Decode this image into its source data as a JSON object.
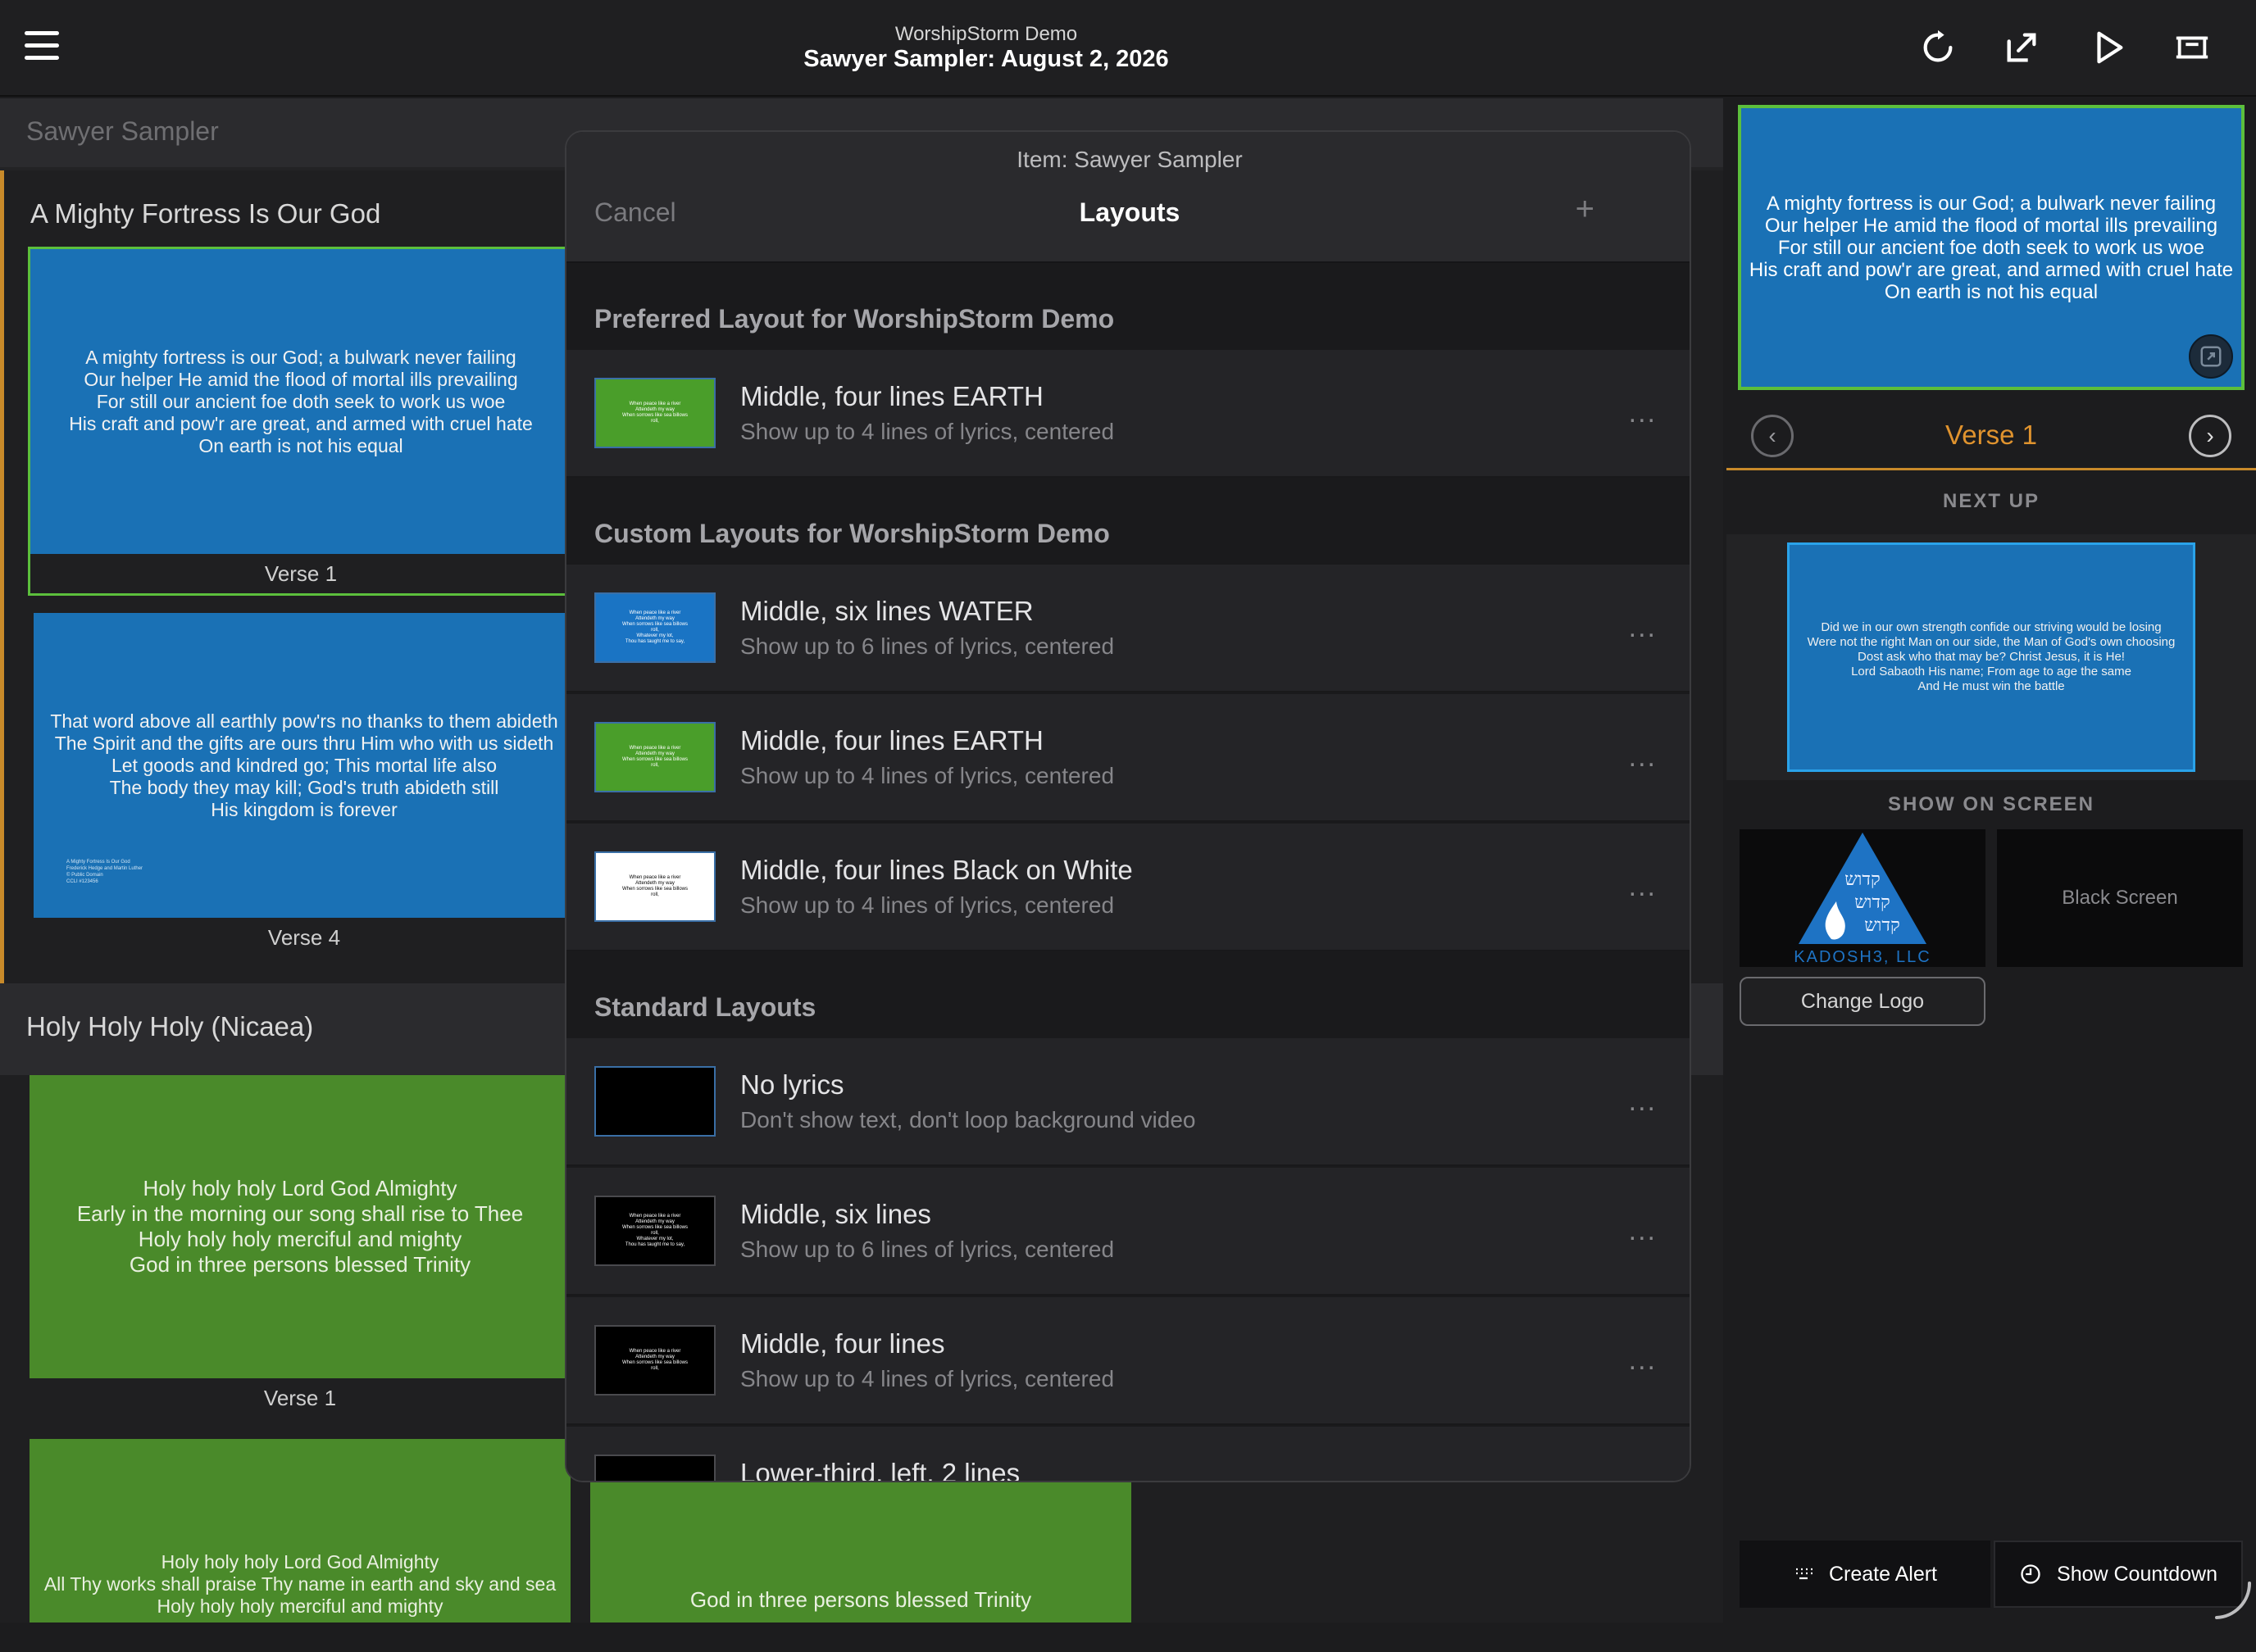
{
  "topbar": {
    "app_title": "WorshipStorm Demo",
    "doc_title": "Sawyer Sampler: August 2, 2026"
  },
  "service": {
    "header": "Sawyer Sampler",
    "songs": [
      {
        "title": "A Mighty Fortress Is Our God",
        "slides": [
          {
            "label": "Verse 1",
            "lyrics": "A mighty fortress is our God; a bulwark never failing\nOur helper He amid the flood of mortal ills prevailing\nFor still our ancient foe doth seek to work us woe\nHis craft and pow'r are great, and armed with cruel hate\nOn earth is not his equal"
          },
          {
            "label": "Verse 4",
            "lyrics": "That word above all earthly pow'rs no thanks to them abideth\nThe Spirit and the gifts are ours thru Him who with us sideth\nLet goods and kindred go; This mortal life also\nThe body they may kill; God's truth abideth still\nHis kingdom is forever",
            "credit": "A Mighty Fortress Is Our God\nFrederick Hedge and Martin Luther\n© Public Domain\nCCLI #123456"
          }
        ]
      },
      {
        "title": "Holy Holy Holy (Nicaea)",
        "slides": [
          {
            "label": "Verse 1",
            "lyrics": "Holy holy holy Lord God Almighty\nEarly in the morning our song shall rise to Thee\nHoly holy holy merciful and mighty\nGod in three persons blessed Trinity"
          },
          {
            "label": "",
            "lyrics": "Holy holy holy Lord God Almighty\nAll Thy works shall praise Thy name in earth and sky and sea\nHoly holy holy merciful and mighty"
          },
          {
            "label": "",
            "lyrics": "God in three persons blessed Trinity"
          }
        ]
      }
    ]
  },
  "modal": {
    "item_label": "Item: Sawyer Sampler",
    "cancel": "Cancel",
    "title": "Layouts",
    "add": "+",
    "groups": [
      {
        "heading": "Preferred Layout for WorshipStorm Demo",
        "rows": [
          {
            "name": "Middle, four lines EARTH",
            "desc": "Show up to 4 lines of lyrics, centered",
            "thumb": "earth",
            "thumb_text": "When peace like a river\nAttendeth my way\nWhen sorrows like sea billows\nroll,"
          }
        ]
      },
      {
        "heading": "Custom Layouts for WorshipStorm Demo",
        "rows": [
          {
            "name": "Middle, six lines WATER",
            "desc": "Show up to 6 lines of lyrics, centered",
            "thumb": "water",
            "thumb_text": "When peace like a river\nAttendeth my way\nWhen sorrows like sea billows\nroll,\nWhatever my lot,\nThou has taught me to say,"
          },
          {
            "name": "Middle, four lines EARTH",
            "desc": "Show up to 4 lines of lyrics, centered",
            "thumb": "earth",
            "thumb_text": "When peace like a river\nAttendeth my way\nWhen sorrows like sea billows\nroll,"
          },
          {
            "name": "Middle, four lines Black on White",
            "desc": "Show up to 4 lines of lyrics, centered",
            "thumb": "white",
            "thumb_text": "When peace like a river\nAttendeth my way\nWhen sorrows like sea billows\nroll,"
          }
        ]
      },
      {
        "heading": "Standard Layouts",
        "rows": [
          {
            "name": "No lyrics",
            "desc": "Don't show text, don't loop background video",
            "thumb": "black",
            "thumb_text": ""
          },
          {
            "name": "Middle, six lines",
            "desc": "Show up to 6 lines of lyrics, centered",
            "thumb": "black",
            "thumb_text": "When peace like a river\nAttendeth my way\nWhen sorrows like sea billows\nroll,\nWhatever my lot,\nThou has taught me to say,"
          },
          {
            "name": "Middle, four lines",
            "desc": "Show up to 4 lines of lyrics, centered",
            "thumb": "black",
            "thumb_text": "When peace like a river\nAttendeth my way\nWhen sorrows like sea billows\nroll,"
          },
          {
            "name": "Lower-third, left, 2 lines",
            "desc": "",
            "thumb": "black",
            "thumb_text": ""
          }
        ]
      }
    ],
    "more": "..."
  },
  "live": {
    "lyrics": "A mighty fortress is our God; a bulwark never failing\nOur helper He amid the flood of mortal ills prevailing\nFor still our ancient foe doth seek to work us woe\nHis craft and pow'r are great, and armed with cruel hate\nOn earth is not his equal",
    "current_verse": "Verse 1"
  },
  "next_up": {
    "label": "NEXT UP",
    "lyrics": "Did we in our own strength confide our striving would be losing\nWere not the right Man on our side, the Man of God's own choosing\nDost ask who that may be? Christ Jesus, it is He!\nLord Sabaoth His name; From age to age the same\nAnd He must win the battle"
  },
  "show_on_screen": {
    "label": "SHOW ON SCREEN",
    "black_screen": "Black Screen",
    "change_logo": "Change Logo",
    "logo_text": "KADOSH3, LLC",
    "logo_hebrew": "קדוש\nקדוש\nקדוש"
  },
  "bottom": {
    "create_alert": "Create Alert",
    "show_countdown": "Show Countdown"
  },
  "colors": {
    "accent_orange": "#e0932e",
    "selected_green": "#5cbf3c",
    "slide_blue": "#1a71b5",
    "slide_green": "#4a8a2a"
  }
}
